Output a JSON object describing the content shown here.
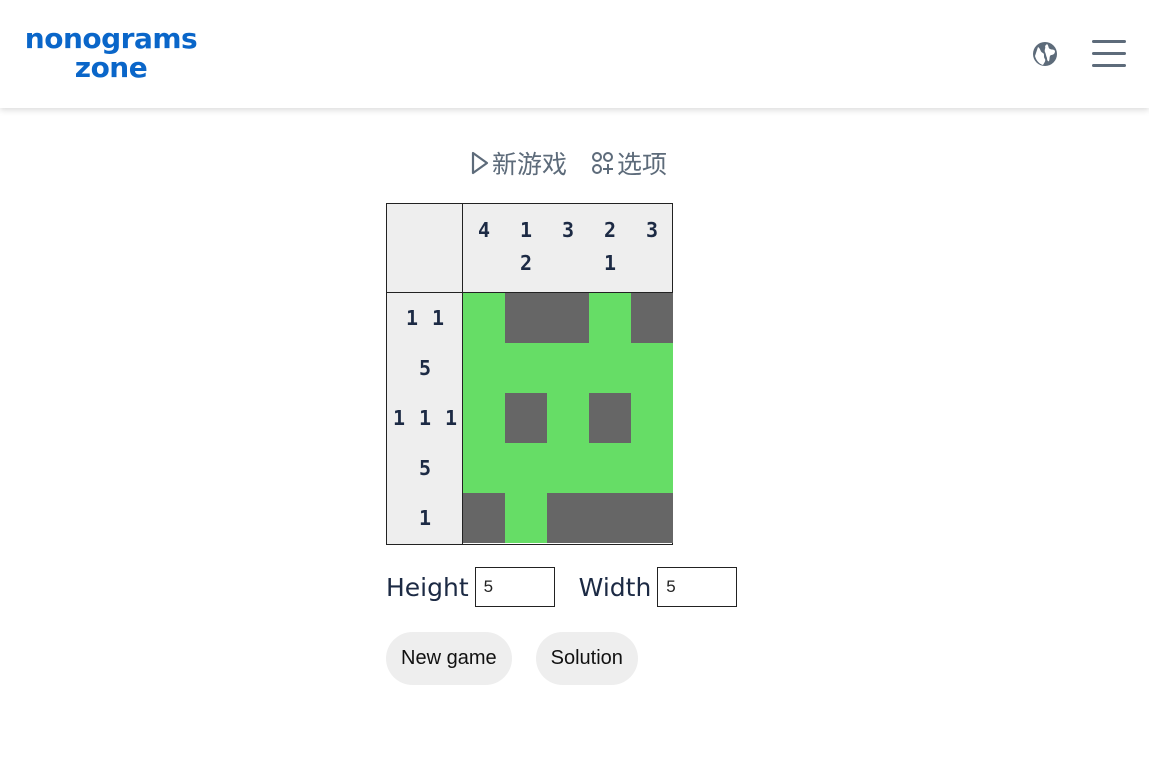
{
  "header": {
    "logo_line1": "nonograms",
    "logo_line2": "zone",
    "globe_icon": "globe-icon",
    "menu_icon": "hamburger-menu-icon",
    "brand_color": "#0a66c9"
  },
  "toolbar": {
    "new_game_label": "新游戏",
    "new_game_icon": "play-outline-icon",
    "options_label": "选项",
    "options_icon": "options-dots-icon"
  },
  "puzzle": {
    "rows": 5,
    "cols": 5,
    "column_clues": [
      [
        "4"
      ],
      [
        "1",
        "2"
      ],
      [
        "3"
      ],
      [
        "2",
        "1"
      ],
      [
        "3"
      ]
    ],
    "row_clues": [
      [
        "1",
        "1"
      ],
      [
        "5"
      ],
      [
        "1",
        "1",
        "1"
      ],
      [
        "5"
      ],
      [
        "1"
      ]
    ],
    "cells": [
      [
        1,
        0,
        0,
        1,
        0
      ],
      [
        1,
        1,
        1,
        1,
        1
      ],
      [
        1,
        0,
        1,
        0,
        1
      ],
      [
        1,
        1,
        1,
        1,
        1
      ],
      [
        0,
        1,
        0,
        0,
        0
      ]
    ],
    "filled_color": "#66dd66",
    "empty_color": "#666666"
  },
  "settings": {
    "height_label": "Height",
    "height_value": "5",
    "width_label": "Width",
    "width_value": "5"
  },
  "buttons": {
    "new_game": "New game",
    "solution": "Solution"
  }
}
